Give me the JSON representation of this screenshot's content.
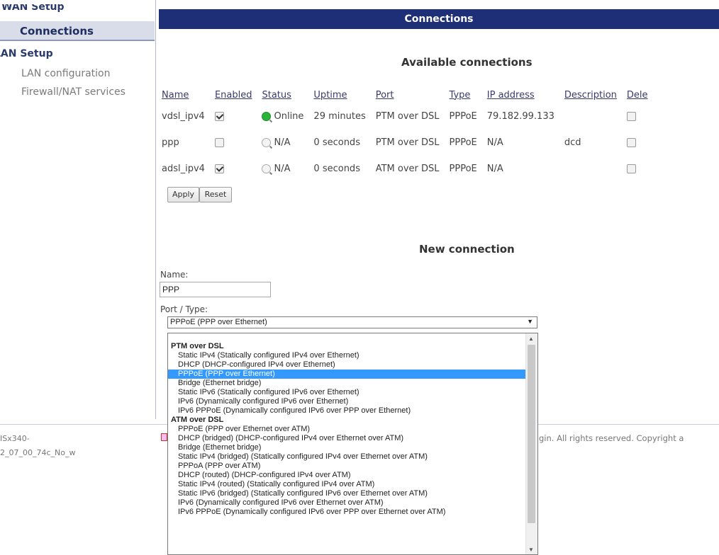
{
  "sidebar": {
    "wan_setup": "WAN Setup",
    "connections": "Connections",
    "lan_setup": "LAN Setup",
    "lan_configuration": "LAN configuration",
    "firewall": "Firewall/NAT services"
  },
  "header": {
    "title": "Connections"
  },
  "available": {
    "title": "Available connections",
    "columns": [
      "Name",
      "Enabled",
      "Status",
      "Uptime",
      "Port",
      "Type",
      "IP address",
      "Description",
      "Dele"
    ],
    "rows": [
      {
        "name": "vdsl_ipv4",
        "enabled": true,
        "status": "Online",
        "status_state": "online",
        "uptime": "29 minutes",
        "port": "PTM over DSL",
        "type": "PPPoE",
        "ip": "79.182.99.133",
        "description": "",
        "delete": false
      },
      {
        "name": "ppp",
        "enabled": false,
        "status": "N/A",
        "status_state": "na",
        "uptime": "0 seconds",
        "port": "PTM over DSL",
        "type": "PPPoE",
        "ip": "N/A",
        "description": "dcd",
        "delete": false
      },
      {
        "name": "adsl_ipv4",
        "enabled": true,
        "status": "N/A",
        "status_state": "na",
        "uptime": "0 seconds",
        "port": "ATM over DSL",
        "type": "PPPoE",
        "ip": "N/A",
        "description": "",
        "delete": false
      }
    ],
    "apply_label": "Apply",
    "reset_label": "Reset"
  },
  "new_connection": {
    "title": "New connection",
    "name_label": "Name:",
    "name_value": "PPP",
    "port_type_label": "Port / Type:",
    "selected": "PPPoE (PPP over Ethernet)",
    "groups": [
      {
        "label": "PTM over DSL",
        "options": [
          {
            "text": "Static IPv4 (Statically configured IPv4 over Ethernet)"
          },
          {
            "text": "DHCP (DHCP-configured IPv4 over Ethernet)"
          },
          {
            "text": "PPPoE (PPP over Ethernet)",
            "selected": true
          },
          {
            "text": "Bridge (Ethernet bridge)"
          },
          {
            "text": "Static IPv6 (Statically configured IPv6 over Ethernet)"
          },
          {
            "text": "IPv6 (Dynamically configured IPv6 over Ethernet)"
          },
          {
            "text": "IPv6 PPPoE (Dynamically configured IPv6 over PPP over Ethernet)"
          }
        ]
      },
      {
        "label": "ATM over DSL",
        "options": [
          {
            "text": "PPPoE (PPP over Ethernet over ATM)"
          },
          {
            "text": "DHCP (bridged) (DHCP-configured IPv4 over Ethernet over ATM)"
          },
          {
            "text": "Bridge (Ethernet bridge)"
          },
          {
            "text": "Static IPv4 (bridged) (Statically configured IPv4 over Ethernet over ATM)"
          },
          {
            "text": "PPPoA (PPP over ATM)"
          },
          {
            "text": "DHCP (routed) (DHCP-configured IPv4 over ATM)"
          },
          {
            "text": "Static IPv4 (routed) (Statically configured IPv4 over ATM)"
          },
          {
            "text": "Static IPv6 (bridged) (Statically configured IPv6 over Ethernet over ATM)"
          },
          {
            "text": "IPv6 (Dynamically configured IPv6 over Ethernet over ATM)"
          },
          {
            "text": "IPv6 PPPoE (Dynamically configured IPv6 over PPP over Ethernet over ATM)"
          }
        ]
      }
    ]
  },
  "footer": {
    "left_line1": "ISx340-",
    "left_line2": "2_07_00_74c_No_w",
    "right": "gin. All rights reserved. Copyright a"
  }
}
